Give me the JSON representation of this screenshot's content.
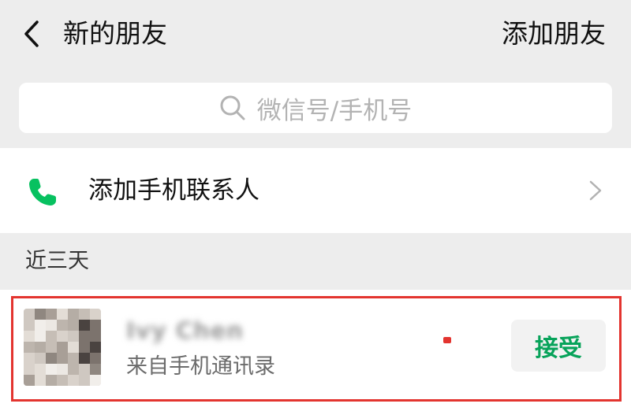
{
  "navbar": {
    "title": "新的朋友",
    "action_label": "添加朋友",
    "back_icon": "chevron-left-icon"
  },
  "search": {
    "placeholder": "微信号/手机号",
    "icon": "search-icon"
  },
  "add_contacts_row": {
    "label": "添加手机联系人",
    "icon": "phone-icon",
    "icon_color": "#07c160",
    "arrow_icon": "chevron-right-icon"
  },
  "section": {
    "title": "近三天"
  },
  "requests": [
    {
      "name": "Ivy Chen",
      "source": "来自手机通讯录",
      "accept_label": "接受",
      "accept_color": "#07a35a"
    }
  ],
  "colors": {
    "background": "#ededed",
    "surface": "#ffffff",
    "highlight": "#e3342f"
  }
}
